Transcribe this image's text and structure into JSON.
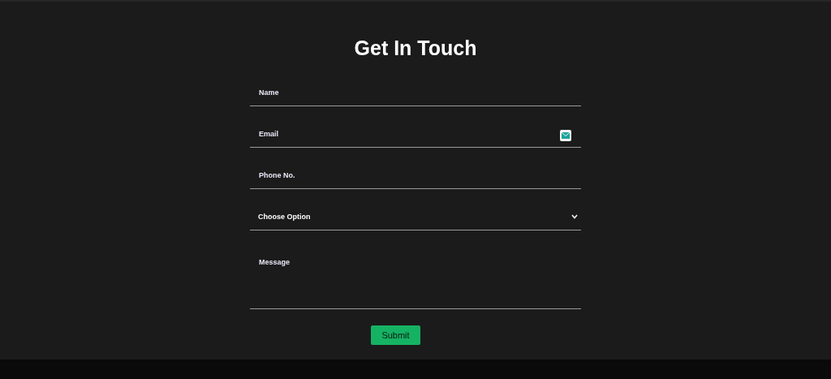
{
  "title": "Get In Touch",
  "fields": [
    {
      "kind": "text",
      "placeholder": "Name"
    },
    {
      "kind": "email",
      "placeholder": "Email"
    },
    {
      "kind": "text",
      "placeholder": "Phone No."
    },
    {
      "kind": "select",
      "value": "Choose Option"
    },
    {
      "kind": "textarea",
      "placeholder": "Message"
    }
  ],
  "submit": "Submit"
}
